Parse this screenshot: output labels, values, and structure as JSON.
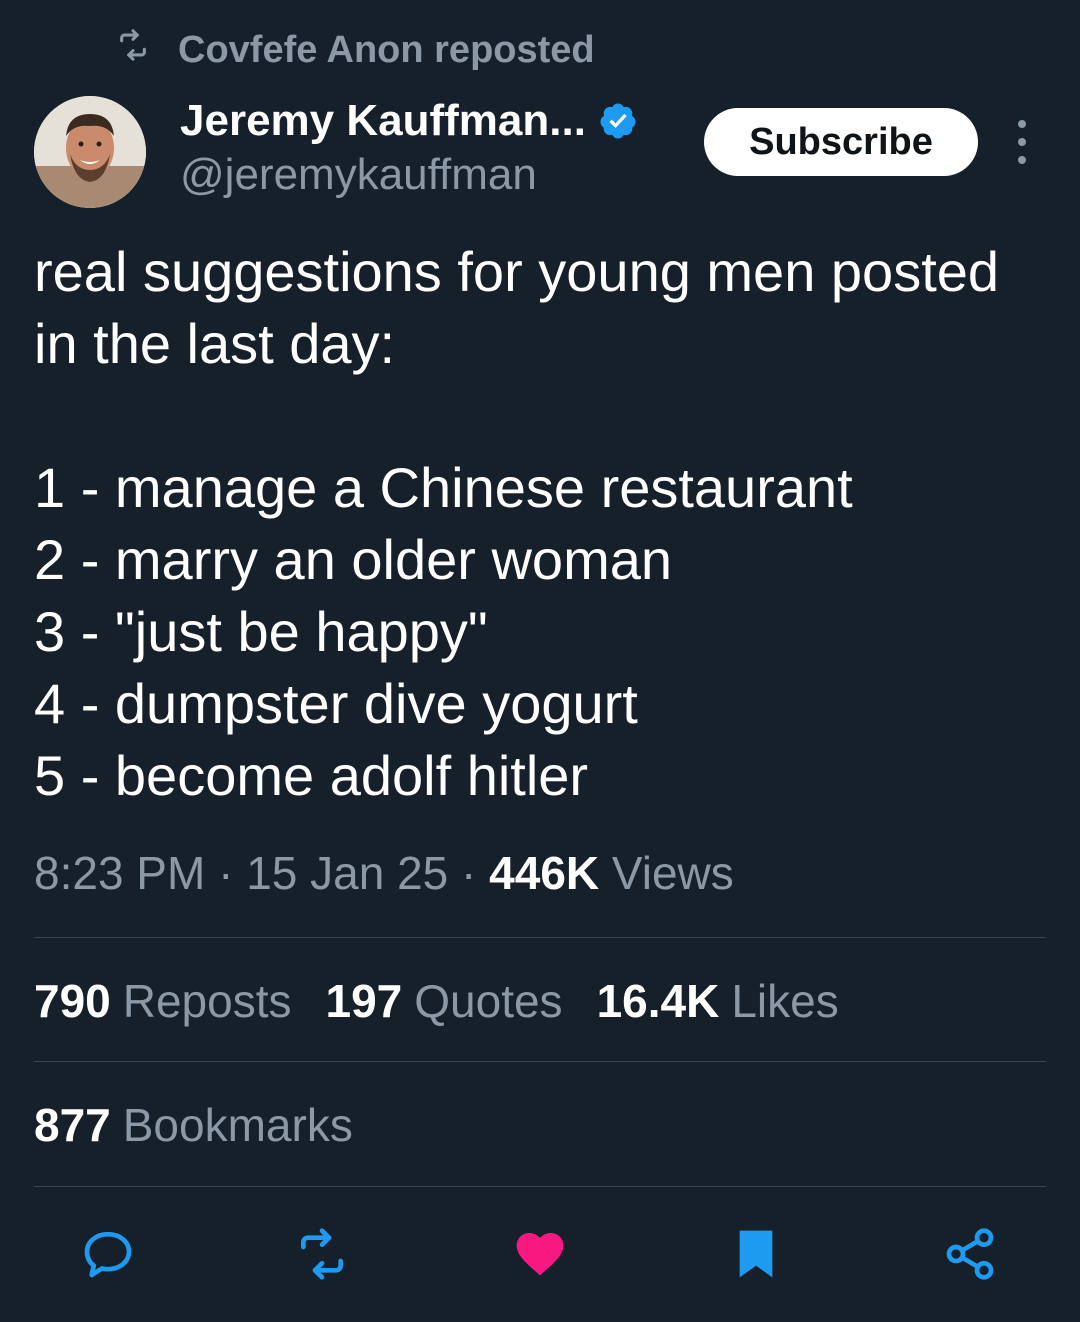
{
  "repost": {
    "text": "Covfefe Anon reposted",
    "icon": "repost-icon"
  },
  "author": {
    "name": "Jeremy Kauffman...",
    "handle": "@jeremykauffman",
    "verified": true,
    "verified_color": "#1d9bf0"
  },
  "subscribe_label": "Subscribe",
  "tweet": {
    "lines": [
      "real suggestions for young men posted",
      "in the last day:",
      "",
      "1 - manage a Chinese restaurant",
      "2 - marry an older woman",
      "3 - \"just be happy\"",
      "4 - dumpster dive yogurt",
      "5 - become adolf hitler"
    ]
  },
  "meta": {
    "time": "8:23 PM",
    "date": "15 Jan 25",
    "views_count": "446K",
    "views_label": "Views",
    "separator": "·"
  },
  "stats": {
    "reposts_count": "790",
    "reposts_label": "Reposts",
    "quotes_count": "197",
    "quotes_label": "Quotes",
    "likes_count": "16.4K",
    "likes_label": "Likes",
    "bookmarks_count": "877",
    "bookmarks_label": "Bookmarks"
  },
  "actions": [
    {
      "name": "reply",
      "icon": "reply-icon",
      "color": "#1d9bf0"
    },
    {
      "name": "repost",
      "icon": "repost-icon",
      "color": "#1d9bf0"
    },
    {
      "name": "like",
      "icon": "heart-icon",
      "color": "#f91880"
    },
    {
      "name": "bookmark",
      "icon": "bookmark-icon",
      "color": "#1d9bf0"
    },
    {
      "name": "share",
      "icon": "share-icon",
      "color": "#1d9bf0"
    }
  ],
  "colors": {
    "background": "#15202b",
    "secondary_text": "#8b98a5",
    "divider": "#38444d",
    "accent": "#1d9bf0",
    "like": "#f91880"
  }
}
